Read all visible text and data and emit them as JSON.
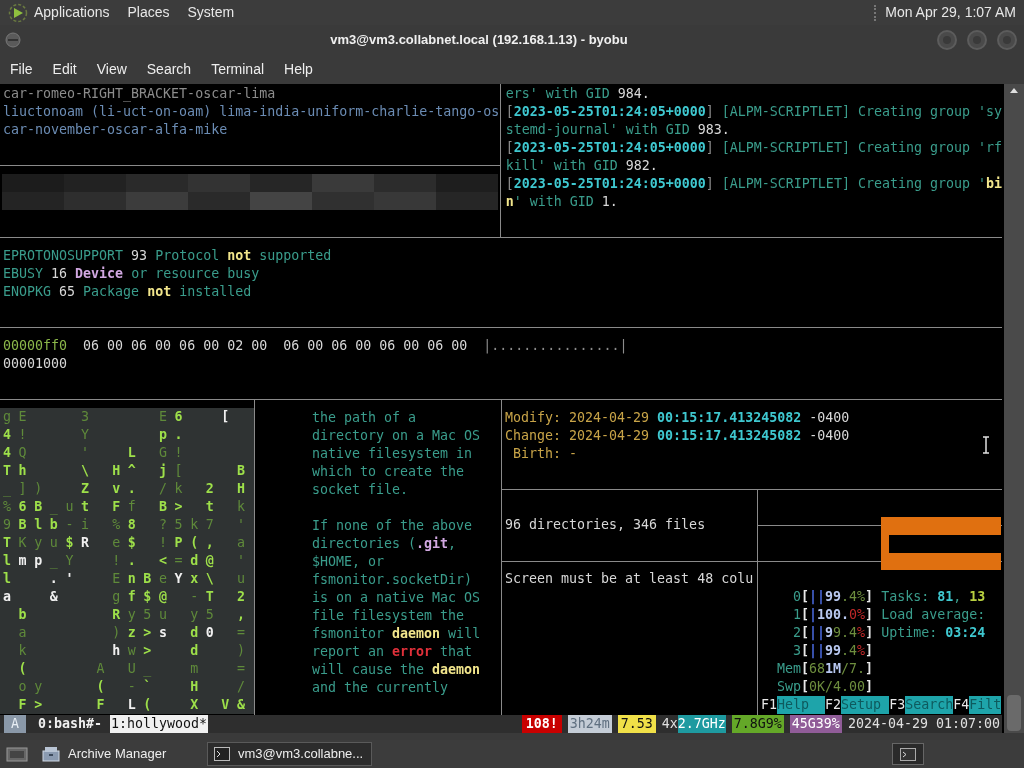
{
  "top_panel": {
    "menus": [
      "Applications",
      "Places",
      "System"
    ],
    "clock": "Mon Apr 29, 1:07 AM"
  },
  "window": {
    "title": "vm3@vm3.collabnet.local (192.168.1.13) - byobu",
    "menu": [
      "File",
      "Edit",
      "View",
      "Search",
      "Terminal",
      "Help"
    ]
  },
  "name_pane": {
    "lines": [
      [
        {
          "text": "car-romeo-RIGHT_BRACKET-oscar-lima",
          "kind": "dim"
        }
      ],
      [
        {
          "text": "liuctonoam (li-uct-on-oam) lima-india-uniform-charlie-tango-os",
          "kind": "blue"
        }
      ],
      [
        {
          "text": "car-november-oscar-alfa-mike",
          "kind": "blue"
        }
      ]
    ]
  },
  "log_pane": {
    "lines": [
      [
        {
          "text": "ers' with GID ",
          "kind": "teal"
        },
        {
          "text": "984.",
          "kind": "white"
        }
      ],
      [
        {
          "text": "[",
          "kind": "dim"
        },
        {
          "text": "2023-05-25T01:24:05+0000",
          "kind": "cyan"
        },
        {
          "text": "]",
          "kind": "dim"
        },
        {
          "text": " [ALPM-SCRIPTLET] Creating group 'sy",
          "kind": "teal"
        }
      ],
      [
        {
          "text": "stemd-journal' with GID ",
          "kind": "teal"
        },
        {
          "text": "983.",
          "kind": "white"
        }
      ],
      [
        {
          "text": "[",
          "kind": "dim"
        },
        {
          "text": "2023-05-25T01:24:05+0000",
          "kind": "cyan"
        },
        {
          "text": "]",
          "kind": "dim"
        },
        {
          "text": " [ALPM-SCRIPTLET] Creating group 'rf",
          "kind": "teal"
        }
      ],
      [
        {
          "text": "kill' with GID ",
          "kind": "teal"
        },
        {
          "text": "982.",
          "kind": "white"
        }
      ],
      [
        {
          "text": "[",
          "kind": "dim"
        },
        {
          "text": "2023-05-25T01:24:05+0000",
          "kind": "cyan"
        },
        {
          "text": "]",
          "kind": "dim"
        },
        {
          "text": " [ALPM-SCRIPTLET] Creating group '",
          "kind": "teal"
        },
        {
          "text": "bi",
          "kind": "yellow"
        }
      ],
      [
        {
          "text": "n",
          "kind": "yellow"
        },
        {
          "text": "' with GID ",
          "kind": "teal"
        },
        {
          "text": "1.",
          "kind": "white"
        }
      ]
    ]
  },
  "errno_pane": {
    "lines": [
      [
        {
          "text": "EPROTONOSUPPORT ",
          "kind": "teal"
        },
        {
          "text": "93 ",
          "kind": "white"
        },
        {
          "text": "Protocol ",
          "kind": "teal"
        },
        {
          "text": "not",
          "kind": "yellow"
        },
        {
          "text": " supported",
          "kind": "teal"
        }
      ],
      [
        {
          "text": "EBUSY ",
          "kind": "teal"
        },
        {
          "text": "16 ",
          "kind": "white"
        },
        {
          "text": "Device",
          "kind": "purple"
        },
        {
          "text": " or resource busy",
          "kind": "teal"
        }
      ],
      [
        {
          "text": "ENOPKG ",
          "kind": "teal"
        },
        {
          "text": "65 ",
          "kind": "white"
        },
        {
          "text": "Package ",
          "kind": "teal"
        },
        {
          "text": "not",
          "kind": "yellow"
        },
        {
          "text": " installed",
          "kind": "teal"
        }
      ]
    ]
  },
  "hexdump_pane": {
    "lines": [
      [
        {
          "text": "00000ff0",
          "kind": "green"
        },
        {
          "text": "  06 00 06 00 06 00 02 00  06 00 06 00 06 00 06 00  ",
          "kind": "white"
        },
        {
          "text": "|................|",
          "kind": "dim"
        }
      ],
      [
        {
          "text": "00001000",
          "kind": "white"
        }
      ]
    ]
  },
  "matrix_pane": {
    "rows": [
      [
        {
          "ch": "g",
          "kind": "dim"
        },
        {
          "ch": "E",
          "kind": "dim"
        },
        null,
        null,
        null,
        {
          "ch": "3",
          "kind": "dim"
        },
        null,
        null,
        null,
        null,
        {
          "ch": "E",
          "kind": "dim"
        },
        {
          "ch": "6",
          "kind": "bright"
        },
        null,
        null,
        {
          "ch": "[",
          "kind": "white"
        }
      ],
      [
        {
          "ch": "4",
          "kind": "bright"
        },
        {
          "ch": "!",
          "kind": "dim"
        },
        null,
        null,
        null,
        {
          "ch": "Y",
          "kind": "dim"
        },
        null,
        null,
        null,
        null,
        {
          "ch": "p",
          "kind": "bright"
        },
        {
          "ch": ".",
          "kind": "bright"
        }
      ],
      [
        {
          "ch": "4",
          "kind": "bright"
        },
        {
          "ch": "Q",
          "kind": "dim"
        },
        null,
        null,
        null,
        {
          "ch": "'",
          "kind": "dim"
        },
        null,
        null,
        {
          "ch": "L",
          "kind": "bright"
        },
        null,
        {
          "ch": "G",
          "kind": "dim"
        },
        {
          "ch": "!",
          "kind": "dim"
        }
      ],
      [
        {
          "ch": "T",
          "kind": "bright"
        },
        {
          "ch": "h",
          "kind": "bright"
        },
        null,
        null,
        null,
        {
          "ch": "\\",
          "kind": "bright"
        },
        null,
        {
          "ch": "H",
          "kind": "bright"
        },
        {
          "ch": "^",
          "kind": "bright"
        },
        null,
        {
          "ch": "j",
          "kind": "bright"
        },
        {
          "ch": "[",
          "kind": "dim"
        },
        null,
        null,
        null,
        {
          "ch": "B",
          "kind": "bright"
        }
      ],
      [
        {
          "ch": "_",
          "kind": "dim"
        },
        {
          "ch": "]",
          "kind": "dim"
        },
        {
          "ch": ")",
          "kind": "dim"
        },
        null,
        null,
        {
          "ch": "Z",
          "kind": "bright"
        },
        null,
        {
          "ch": "v",
          "kind": "bright"
        },
        {
          "ch": ".",
          "kind": "bright"
        },
        null,
        {
          "ch": "/",
          "kind": "dim"
        },
        {
          "ch": "k",
          "kind": "dim"
        },
        null,
        {
          "ch": "2",
          "kind": "bright"
        },
        null,
        {
          "ch": "H",
          "kind": "bright"
        }
      ],
      [
        {
          "ch": "%",
          "kind": "dim"
        },
        {
          "ch": "6",
          "kind": "bright"
        },
        {
          "ch": "B",
          "kind": "bright"
        },
        {
          "ch": "_",
          "kind": "dim"
        },
        {
          "ch": "u",
          "kind": "dim"
        },
        {
          "ch": "t",
          "kind": "bright"
        },
        null,
        {
          "ch": "F",
          "kind": "bright"
        },
        {
          "ch": "f",
          "kind": "dim"
        },
        null,
        {
          "ch": "B",
          "kind": "bright"
        },
        {
          "ch": ">",
          "kind": "bright"
        },
        null,
        {
          "ch": "t",
          "kind": "bright"
        },
        null,
        {
          "ch": "k",
          "kind": "dim"
        }
      ],
      [
        {
          "ch": "9",
          "kind": "dim"
        },
        {
          "ch": "B",
          "kind": "bright"
        },
        {
          "ch": "l",
          "kind": "bright"
        },
        {
          "ch": "b",
          "kind": "bright"
        },
        {
          "ch": "-",
          "kind": "dim"
        },
        {
          "ch": "i",
          "kind": "dim"
        },
        null,
        {
          "ch": "%",
          "kind": "dim"
        },
        {
          "ch": "8",
          "kind": "bright"
        },
        null,
        {
          "ch": "?",
          "kind": "dim"
        },
        {
          "ch": "5",
          "kind": "dim"
        },
        {
          "ch": "k",
          "kind": "dim"
        },
        {
          "ch": "7",
          "kind": "dim"
        },
        null,
        {
          "ch": "'",
          "kind": "dim"
        }
      ],
      [
        {
          "ch": "T",
          "kind": "bright"
        },
        {
          "ch": "K",
          "kind": "dim"
        },
        {
          "ch": "y",
          "kind": "dim"
        },
        {
          "ch": "u",
          "kind": "dim"
        },
        {
          "ch": "$",
          "kind": "bright"
        },
        {
          "ch": "R",
          "kind": "white"
        },
        null,
        {
          "ch": "e",
          "kind": "dim"
        },
        {
          "ch": "$",
          "kind": "bright"
        },
        null,
        {
          "ch": "!",
          "kind": "dim"
        },
        {
          "ch": "P",
          "kind": "bright"
        },
        {
          "ch": "(",
          "kind": "bright"
        },
        {
          "ch": ",",
          "kind": "bright"
        },
        null,
        {
          "ch": "a",
          "kind": "dim"
        }
      ],
      [
        {
          "ch": "l",
          "kind": "bright"
        },
        {
          "ch": "m",
          "kind": "white"
        },
        {
          "ch": "p",
          "kind": "white"
        },
        {
          "ch": "_",
          "kind": "dim"
        },
        {
          "ch": "Y",
          "kind": "dim"
        },
        null,
        null,
        {
          "ch": "!",
          "kind": "dim"
        },
        {
          "ch": ".",
          "kind": "bright"
        },
        null,
        {
          "ch": "<",
          "kind": "bright"
        },
        {
          "ch": "=",
          "kind": "dim"
        },
        {
          "ch": "d",
          "kind": "bright"
        },
        {
          "ch": "@",
          "kind": "bright"
        },
        null,
        {
          "ch": "'",
          "kind": "dim"
        }
      ],
      [
        {
          "ch": "l",
          "kind": "bright"
        },
        null,
        null,
        {
          "ch": ".",
          "kind": "white"
        },
        {
          "ch": "'",
          "kind": "white"
        },
        null,
        null,
        {
          "ch": "E",
          "kind": "dim"
        },
        {
          "ch": "n",
          "kind": "bright"
        },
        {
          "ch": "B",
          "kind": "bright"
        },
        {
          "ch": "e",
          "kind": "dim"
        },
        {
          "ch": "Y",
          "kind": "white"
        },
        {
          "ch": "x",
          "kind": "bright"
        },
        {
          "ch": "\\",
          "kind": "bright"
        },
        null,
        {
          "ch": "u",
          "kind": "dim"
        }
      ],
      [
        {
          "ch": "a",
          "kind": "white"
        },
        null,
        null,
        {
          "ch": "&",
          "kind": "white"
        },
        null,
        null,
        null,
        {
          "ch": "g",
          "kind": "dim"
        },
        {
          "ch": "f",
          "kind": "bright"
        },
        {
          "ch": "$",
          "kind": "bright"
        },
        {
          "ch": "@",
          "kind": "bright"
        },
        null,
        {
          "ch": "-",
          "kind": "dim"
        },
        {
          "ch": "T",
          "kind": "bright"
        },
        null,
        {
          "ch": "2",
          "kind": "bright"
        }
      ],
      [
        null,
        {
          "ch": "b",
          "kind": "bright"
        },
        null,
        null,
        null,
        null,
        null,
        {
          "ch": "R",
          "kind": "bright"
        },
        {
          "ch": "y",
          "kind": "dim"
        },
        {
          "ch": "5",
          "kind": "dim"
        },
        {
          "ch": "u",
          "kind": "dim"
        },
        null,
        {
          "ch": "y",
          "kind": "dim"
        },
        {
          "ch": "5",
          "kind": "dim"
        },
        null,
        {
          "ch": ",",
          "kind": "bright"
        }
      ],
      [
        null,
        {
          "ch": "a",
          "kind": "dim"
        },
        null,
        null,
        null,
        null,
        null,
        {
          "ch": ")",
          "kind": "dim"
        },
        {
          "ch": "z",
          "kind": "bright"
        },
        {
          "ch": ">",
          "kind": "bright"
        },
        {
          "ch": "s",
          "kind": "white"
        },
        null,
        {
          "ch": "d",
          "kind": "bright"
        },
        {
          "ch": "0",
          "kind": "white"
        },
        null,
        {
          "ch": "=",
          "kind": "dim"
        }
      ],
      [
        null,
        {
          "ch": "k",
          "kind": "dim"
        },
        null,
        null,
        null,
        null,
        null,
        {
          "ch": "h",
          "kind": "white"
        },
        {
          "ch": "w",
          "kind": "dim"
        },
        {
          "ch": ">",
          "kind": "bright"
        },
        null,
        null,
        {
          "ch": "d",
          "kind": "bright"
        },
        null,
        null,
        {
          "ch": ")",
          "kind": "dim"
        }
      ],
      [
        null,
        {
          "ch": "(",
          "kind": "bright"
        },
        null,
        null,
        null,
        null,
        {
          "ch": "A",
          "kind": "dim"
        },
        null,
        {
          "ch": "U",
          "kind": "dim"
        },
        {
          "ch": "_",
          "kind": "dim"
        },
        null,
        null,
        {
          "ch": "m",
          "kind": "dim"
        },
        null,
        null,
        {
          "ch": "=",
          "kind": "dim"
        }
      ],
      [
        null,
        {
          "ch": "o",
          "kind": "dim"
        },
        {
          "ch": "y",
          "kind": "dim"
        },
        null,
        null,
        null,
        {
          "ch": "(",
          "kind": "bright"
        },
        null,
        {
          "ch": "-",
          "kind": "dim"
        },
        {
          "ch": "`",
          "kind": "bright"
        },
        null,
        null,
        {
          "ch": "H",
          "kind": "bright"
        },
        null,
        null,
        {
          "ch": "/",
          "kind": "dim"
        }
      ],
      [
        null,
        {
          "ch": "F",
          "kind": "bright"
        },
        {
          "ch": ">",
          "kind": "bright"
        },
        null,
        null,
        null,
        {
          "ch": "F",
          "kind": "bright"
        },
        null,
        {
          "ch": "L",
          "kind": "white"
        },
        {
          "ch": "(",
          "kind": "bright"
        },
        null,
        null,
        {
          "ch": "X",
          "kind": "bright"
        },
        null,
        {
          "ch": "V",
          "kind": "bright"
        },
        {
          "ch": "&",
          "kind": "bright"
        }
      ]
    ]
  },
  "man_pane": {
    "paragraphs": [
      [
        [
          {
            "text": "the path of a",
            "kind": "teal"
          }
        ],
        [
          {
            "text": "directory on a Mac OS",
            "kind": "teal"
          }
        ],
        [
          {
            "text": "native filesystem in",
            "kind": "teal"
          }
        ],
        [
          {
            "text": "which to create the",
            "kind": "teal"
          }
        ],
        [
          {
            "text": "socket file.",
            "kind": "teal"
          }
        ]
      ],
      [
        [
          {
            "text": "If none of the above",
            "kind": "teal"
          }
        ],
        [
          {
            "text": "directories (",
            "kind": "teal"
          },
          {
            "text": ".git",
            "kind": "purple"
          },
          {
            "text": ",",
            "kind": "teal"
          }
        ],
        [
          {
            "text": "$HOME, or",
            "kind": "teal"
          }
        ],
        [
          {
            "text": "fsmonitor.socketDir)",
            "kind": "teal"
          }
        ],
        [
          {
            "text": "is on a native Mac OS",
            "kind": "teal"
          }
        ],
        [
          {
            "text": "file filesystem the",
            "kind": "teal"
          }
        ],
        [
          {
            "text": "fsmonitor ",
            "kind": "teal"
          },
          {
            "text": "daemon",
            "kind": "yellow"
          },
          {
            "text": " will",
            "kind": "teal"
          }
        ],
        [
          {
            "text": "report an ",
            "kind": "teal"
          },
          {
            "text": "error",
            "kind": "red"
          },
          {
            "text": " that",
            "kind": "teal"
          }
        ],
        [
          {
            "text": "will cause the ",
            "kind": "teal"
          },
          {
            "text": "daemon",
            "kind": "yellow"
          }
        ],
        [
          {
            "text": "and the currently",
            "kind": "teal"
          }
        ]
      ]
    ]
  },
  "stat_pane": {
    "lines": [
      [
        {
          "text": "Modify: 2024-04-29 ",
          "kind": "gold"
        },
        {
          "text": "00:15:17.413245082",
          "kind": "cyan"
        },
        {
          "text": " -0400",
          "kind": "white"
        }
      ],
      [
        {
          "text": "Change: 2024-04-29 ",
          "kind": "gold"
        },
        {
          "text": "00:15:17.413245082",
          "kind": "cyan"
        },
        {
          "text": " -0400",
          "kind": "white"
        }
      ],
      [
        {
          "text": " Birth: -",
          "kind": "gold"
        }
      ]
    ]
  },
  "tree_pane": {
    "lines": [
      [
        {
          "text": "96 directories, 346 files",
          "kind": "white"
        }
      ]
    ]
  },
  "message_pane": {
    "lines": [
      [
        {
          "text": "Screen must be at least 48 colu",
          "kind": "white"
        }
      ]
    ]
  },
  "htop_pane": {
    "lines": [
      [
        {
          "text": "    0",
          "kind": "teal"
        },
        {
          "text": "[",
          "kind": "bracket"
        },
        {
          "text": "||",
          "kind": "bar"
        },
        {
          "text": "99",
          "kind": "bright"
        },
        {
          "text": ".4%",
          "kind": "olive"
        },
        {
          "text": "]",
          "kind": "bracket"
        },
        {
          "text": " Tasks: ",
          "kind": "teal"
        },
        {
          "text": "81",
          "kind": "cyan"
        },
        {
          "text": ", ",
          "kind": "teal"
        },
        {
          "text": "13",
          "kind": "lime"
        }
      ],
      [
        {
          "text": "    1",
          "kind": "teal"
        },
        {
          "text": "[",
          "kind": "bracket"
        },
        {
          "text": "|",
          "kind": "bar"
        },
        {
          "text": "100.",
          "kind": "bright"
        },
        {
          "text": "0%",
          "kind": "redplain"
        },
        {
          "text": "]",
          "kind": "bracket"
        },
        {
          "text": " Load average:",
          "kind": "teal"
        }
      ],
      [
        {
          "text": "    2",
          "kind": "teal"
        },
        {
          "text": "[",
          "kind": "bracket"
        },
        {
          "text": "||",
          "kind": "bar"
        },
        {
          "text": "9",
          "kind": "bright"
        },
        {
          "text": "9.4",
          "kind": "olive"
        },
        {
          "text": "%",
          "kind": "redplain"
        },
        {
          "text": "]",
          "kind": "bracket"
        },
        {
          "text": " Uptime: ",
          "kind": "teal"
        },
        {
          "text": "03:24",
          "kind": "cyan"
        }
      ],
      [
        {
          "text": "    3",
          "kind": "teal"
        },
        {
          "text": "[",
          "kind": "bracket"
        },
        {
          "text": "||",
          "kind": "bar"
        },
        {
          "text": "99",
          "kind": "bright"
        },
        {
          "text": ".4",
          "kind": "olive"
        },
        {
          "text": "%",
          "kind": "redplain"
        },
        {
          "text": "]",
          "kind": "bracket"
        }
      ],
      [
        {
          "text": "  Mem",
          "kind": "teal"
        },
        {
          "text": "[",
          "kind": "bracket"
        },
        {
          "text": "68",
          "kind": "olive"
        },
        {
          "text": "1M",
          "kind": "bright"
        },
        {
          "text": "/7.",
          "kind": "olive"
        },
        {
          "text": "]",
          "kind": "bracket"
        }
      ],
      [
        {
          "text": "  Swp",
          "kind": "teal"
        },
        {
          "text": "[",
          "kind": "bracket"
        },
        {
          "text": "0K/4.00",
          "kind": "olive"
        },
        {
          "text": "]",
          "kind": "bracket"
        }
      ]
    ],
    "function_keys": [
      {
        "key": "F1",
        "label": "Help  "
      },
      {
        "key": "F2",
        "label": "Setup "
      },
      {
        "key": "F3",
        "label": "Search"
      },
      {
        "key": "F4",
        "label": "Filt"
      }
    ]
  },
  "status_bar": {
    "session": "A",
    "windows": [
      {
        "label": "0:bash#-",
        "selected": false
      },
      {
        "label": "1:hollywood*",
        "selected": true
      }
    ],
    "indicators": [
      {
        "text": "108!",
        "kind": "alert"
      },
      {
        "text": "3h24m",
        "kind": "uptime"
      },
      {
        "text": "7.53",
        "kind": "load"
      },
      {
        "text": "4x",
        "kind": "plain"
      },
      {
        "text": "2.7GHz",
        "kind": "cpu"
      },
      {
        "text": "7.8G9%",
        "kind": "mem"
      },
      {
        "text": "45G39%",
        "kind": "disk"
      },
      {
        "text": "2024-04-29 01:07:00",
        "kind": "plain"
      }
    ]
  },
  "taskbar": {
    "items": [
      {
        "label": "Archive Manager",
        "kind": "archive",
        "selected": false
      },
      {
        "label": "vm3@vm3.collabne...",
        "kind": "terminal",
        "selected": true
      }
    ]
  }
}
